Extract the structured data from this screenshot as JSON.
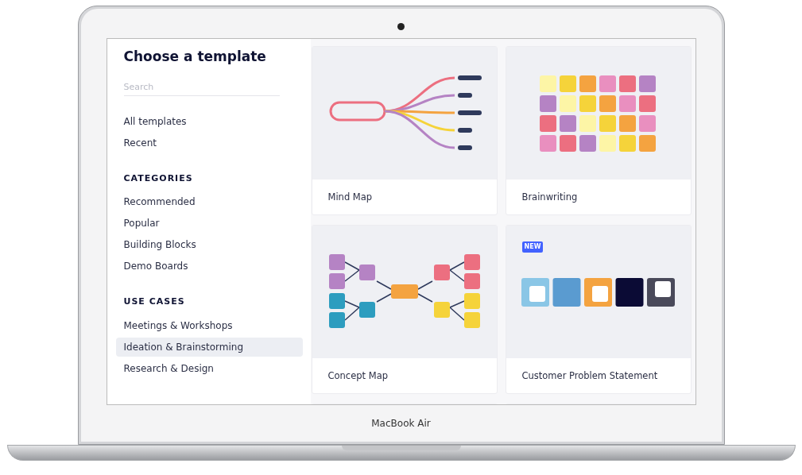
{
  "sidebar": {
    "title": "Choose a template",
    "search": {
      "placeholder": "Search"
    },
    "items": [
      {
        "label": "All templates",
        "selected": false
      },
      {
        "label": "Recent",
        "selected": false
      }
    ],
    "sections": [
      {
        "heading": "CATEGORIES",
        "items": [
          {
            "label": "Recommended",
            "selected": false
          },
          {
            "label": "Popular",
            "selected": false
          },
          {
            "label": "Building Blocks",
            "selected": false
          },
          {
            "label": "Demo Boards",
            "selected": false
          }
        ]
      },
      {
        "heading": "USE CASES",
        "items": [
          {
            "label": "Meetings & Workshops",
            "selected": false
          },
          {
            "label": "Ideation & Brainstorming",
            "selected": true
          },
          {
            "label": "Research & Design",
            "selected": false
          }
        ]
      }
    ]
  },
  "card_rows": [
    {
      "cards": [
        {
          "title": "Mind Map",
          "kind": "mindmap"
        },
        {
          "title": "Brainwriting",
          "kind": "brainwriting"
        }
      ]
    },
    {
      "cards": [
        {
          "title": "Concept Map",
          "kind": "concept"
        },
        {
          "title": "Customer Problem Statement",
          "kind": "problem",
          "badge": "NEW"
        }
      ]
    }
  ],
  "device_label": "MacBook Air"
}
